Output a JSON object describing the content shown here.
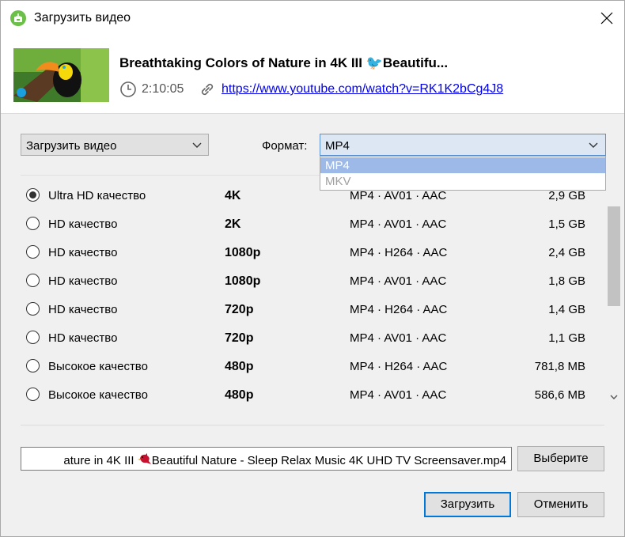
{
  "window": {
    "title": "Загрузить видео"
  },
  "video": {
    "title": "Breathtaking Colors of Nature in 4K III 🐦Beautifu...",
    "duration": "2:10:05",
    "url": "https://www.youtube.com/watch?v=RK1K2bCg4J8"
  },
  "controls": {
    "download_type": "Загрузить видео",
    "format_label": "Формат:",
    "format_value": "MP4",
    "format_options": [
      "MP4",
      "MKV"
    ]
  },
  "qualities": [
    {
      "label": "Ultra HD качество",
      "res": "4K",
      "codec": "MP4 · AV01 · AAC",
      "size": "2,9 GB",
      "selected": true
    },
    {
      "label": "HD качество",
      "res": "2K",
      "codec": "MP4 · AV01 · AAC",
      "size": "1,5 GB",
      "selected": false
    },
    {
      "label": "HD качество",
      "res": "1080p",
      "codec": "MP4 · H264 · AAC",
      "size": "2,4 GB",
      "selected": false
    },
    {
      "label": "HD качество",
      "res": "1080p",
      "codec": "MP4 · AV01 · AAC",
      "size": "1,8 GB",
      "selected": false
    },
    {
      "label": "HD качество",
      "res": "720p",
      "codec": "MP4 · H264 · AAC",
      "size": "1,4 GB",
      "selected": false
    },
    {
      "label": "HD качество",
      "res": "720p",
      "codec": "MP4 · AV01 · AAC",
      "size": "1,1 GB",
      "selected": false
    },
    {
      "label": "Высокое качество",
      "res": "480p",
      "codec": "MP4 · H264 · AAC",
      "size": "781,8 MB",
      "selected": false
    },
    {
      "label": "Высокое качество",
      "res": "480p",
      "codec": "MP4 · AV01 · AAC",
      "size": "586,6 MB",
      "selected": false
    }
  ],
  "output": {
    "filename_before_icon": "ature in 4K III ",
    "filename_after_icon": "Beautiful Nature - Sleep Relax Music 4K UHD TV Screensaver.mp4",
    "browse_label": "Выберите"
  },
  "buttons": {
    "download": "Загрузить",
    "cancel": "Отменить"
  },
  "colors": {
    "accent": "#0078d7",
    "link": "#0000ee",
    "app_icon": "#6cc04a",
    "dropdown_highlight": "#9db9e8"
  },
  "icons": {
    "app": "download-icon",
    "close": "close-icon",
    "clock": "clock-icon",
    "link": "link-icon",
    "bird": "red-bird-emoji"
  }
}
